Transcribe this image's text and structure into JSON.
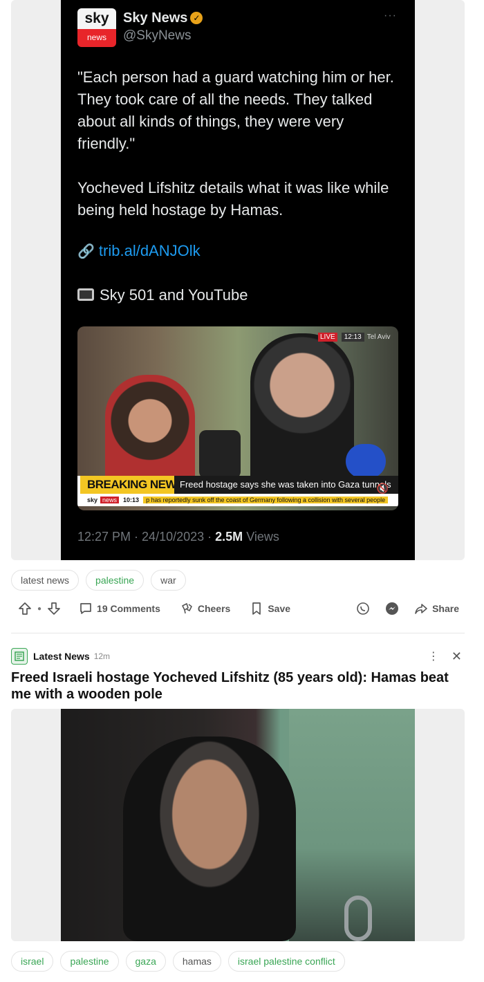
{
  "post1": {
    "tweet": {
      "logo_top": "sky",
      "logo_bottom": "news",
      "account_name": "Sky News",
      "handle": "@SkyNews",
      "more": "···",
      "quote": "\"Each person had a guard watching him or her. They took care of all the needs. They talked about all kinds of things, they were very friendly.\"",
      "description": "Yocheved Lifshitz details what it was like while being held hostage by Hamas.",
      "link": "trib.al/dANJOlk",
      "channel": "Sky 501 and YouTube",
      "video": {
        "live_label": "LIVE",
        "live_time": "12:13",
        "location": "Tel Aviv",
        "breaking": "BREAKING NEWS",
        "headline": "Freed hostage says she was taken into Gaza tunnels",
        "ticker_brand": "sky",
        "ticker_news": "news",
        "ticker_time": "10:13",
        "ticker_text": "p has reportedly sunk off the coast of Germany following a collision with several people"
      },
      "time": "12:27 PM",
      "date": "24/10/2023",
      "views_count": "2.5M",
      "views_label": "Views"
    },
    "tags": [
      "latest news",
      "palestine",
      "war"
    ],
    "actions": {
      "comments": "19 Comments",
      "cheers": "Cheers",
      "save": "Save",
      "share": "Share"
    }
  },
  "post2": {
    "source_name": "Latest News",
    "time_ago": "12m",
    "title": "Freed Israeli hostage Yocheved Lifshitz (85 years old): Hamas beat me with a wooden pole",
    "tags": [
      "israel",
      "palestine",
      "gaza",
      "hamas",
      "israel palestine conflict"
    ]
  },
  "colors": {
    "accent_green": "#3aa655",
    "tweet_link": "#1d9bf0",
    "breaking_yellow": "#f3c623"
  }
}
